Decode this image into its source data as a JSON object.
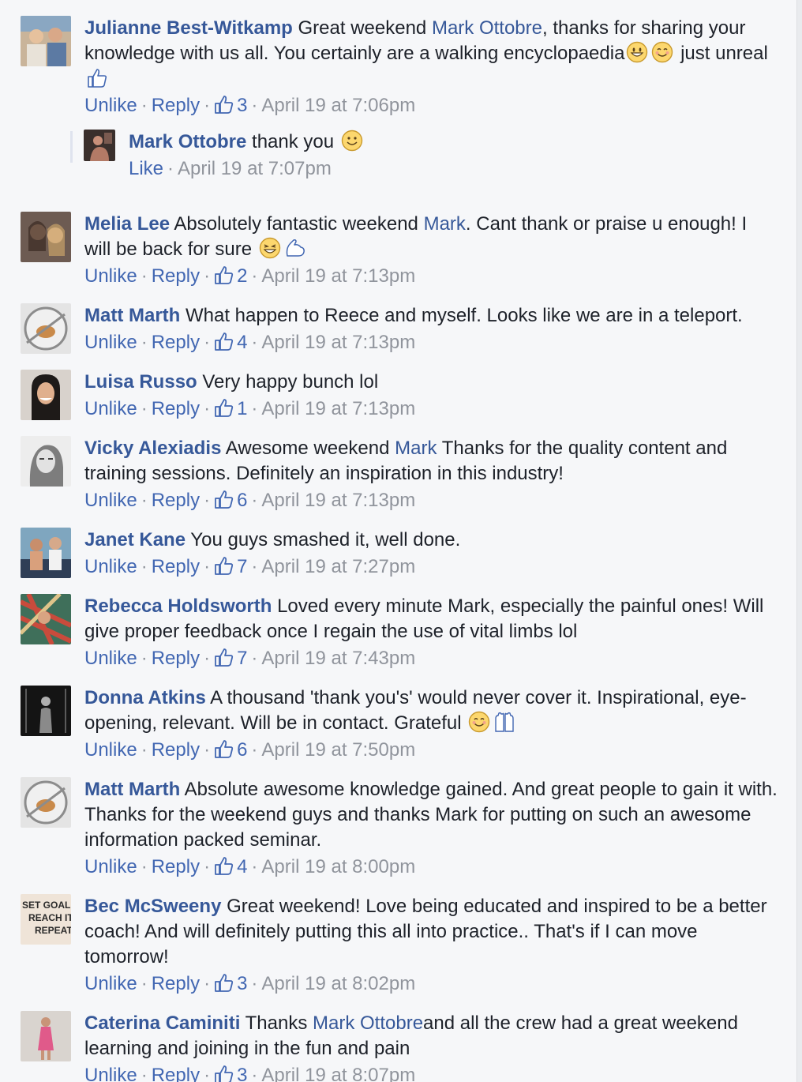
{
  "ui": {
    "unlike": "Unlike",
    "reply": "Reply",
    "like": "Like",
    "dot": "·"
  },
  "comments": [
    {
      "name": "Julianne Best-Witkamp",
      "t1": "Great weekend ",
      "mention": "Mark Ottobre",
      "t2": ", thanks for sharing your knowledge with us all. You certainly are a walking encyclopaedia",
      "t3": " just unreal",
      "likes": "3",
      "time": "April 19 at 7:06pm",
      "reply": {
        "name": "Mark Ottobre",
        "text": "thank you",
        "time": "April 19 at 7:07pm"
      }
    },
    {
      "name": "Melia Lee",
      "t1": "Absolutely fantastic weekend ",
      "mention": "Mark",
      "t2": ". Cant thank or praise u enough! I will be back for sure",
      "likes": "2",
      "time": "April 19 at 7:13pm"
    },
    {
      "name": "Matt Marth",
      "t1": "What happen to Reece and myself. Looks like we are in a teleport.",
      "likes": "4",
      "time": "April 19 at 7:13pm"
    },
    {
      "name": "Luisa Russo",
      "t1": "Very happy bunch lol",
      "likes": "1",
      "time": "April 19 at 7:13pm"
    },
    {
      "name": "Vicky Alexiadis",
      "t1": "Awesome weekend ",
      "mention": "Mark",
      "t2": " Thanks for the quality content and training sessions. Definitely an inspiration in this industry!",
      "likes": "6",
      "time": "April 19 at 7:13pm"
    },
    {
      "name": "Janet Kane",
      "t1": "You guys smashed it, well done.",
      "likes": "7",
      "time": "April 19 at 7:27pm"
    },
    {
      "name": "Rebecca Holdsworth",
      "t1": "Loved every minute Mark, especially the painful ones! Will give proper feedback once I regain the use of vital limbs lol",
      "likes": "7",
      "time": "April 19 at 7:43pm"
    },
    {
      "name": "Donna Atkins",
      "t1": "A thousand 'thank you's' would never cover it. Inspirational, eye-opening, relevant. Will be in contact. Grateful",
      "likes": "6",
      "time": "April 19 at 7:50pm"
    },
    {
      "name": "Matt Marth",
      "t1": "Absolute awesome knowledge gained. And great people to gain it with. Thanks for the weekend guys and thanks Mark for putting on such an awesome information packed seminar.",
      "likes": "4",
      "time": "April 19 at 8:00pm"
    },
    {
      "name": "Bec McSweeny",
      "t1": "Great weekend! Love being educated and inspired to be a better coach! And will definitely putting this all into practice.. That's if I can move tomorrow!",
      "likes": "3",
      "time": "April 19 at 8:02pm",
      "avatar_text": [
        "SET GOAL.",
        "REACH IT.",
        "REPEAT."
      ]
    },
    {
      "name": "Caterina Caminiti",
      "t1": "Thanks ",
      "mention": "Mark Ottobre",
      "t2": "and all the crew had a great weekend learning and joining in the fun and pain",
      "likes": "3",
      "time": "April 19 at 8:07pm"
    }
  ],
  "colors": {
    "link": "#365899",
    "action": "#4267b2",
    "meta": "#90949c",
    "background": "#f6f7f9"
  }
}
